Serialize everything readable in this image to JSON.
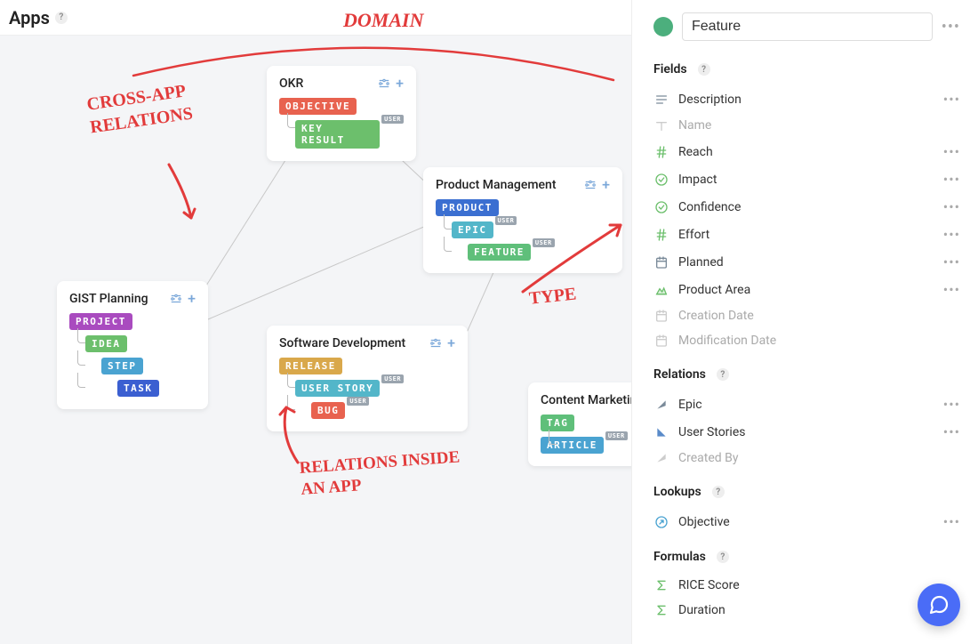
{
  "header": {
    "title": "Apps"
  },
  "annotations": {
    "domain": "DOMAIN",
    "cross_app": "CROSS-APP RELATIONS",
    "type": "TYPE",
    "inside": "RELATIONS INSIDE AN APP"
  },
  "user_badge": "USER",
  "cards": {
    "okr": {
      "title": "OKR",
      "tags": [
        {
          "label": "OBJECTIVE",
          "color": "#e8624f",
          "indent": 0,
          "user": false
        },
        {
          "label": "KEY RESULT",
          "color": "#6cbf6c",
          "indent": 1,
          "user": true
        }
      ]
    },
    "pm": {
      "title": "Product Management",
      "tags": [
        {
          "label": "PRODUCT",
          "color": "#3b6fd1",
          "indent": 0,
          "user": false
        },
        {
          "label": "EPIC",
          "color": "#53b6c9",
          "indent": 1,
          "user": true
        },
        {
          "label": "FEATURE",
          "color": "#5fbf7a",
          "indent": 2,
          "user": true
        }
      ]
    },
    "gist": {
      "title": "GIST Planning",
      "tags": [
        {
          "label": "PROJECT",
          "color": "#a94bbf",
          "indent": 0,
          "user": false
        },
        {
          "label": "IDEA",
          "color": "#6cbf6c",
          "indent": 1,
          "user": false
        },
        {
          "label": "STEP",
          "color": "#4aa3d1",
          "indent": 2,
          "user": false
        },
        {
          "label": "TASK",
          "color": "#3b5fd1",
          "indent": 3,
          "user": false
        }
      ]
    },
    "sw": {
      "title": "Software Development",
      "tags": [
        {
          "label": "RELEASE",
          "color": "#d9a84b",
          "indent": 0,
          "user": false
        },
        {
          "label": "USER STORY",
          "color": "#53b6c9",
          "indent": 1,
          "user": true
        },
        {
          "label": "BUG",
          "color": "#e8624f",
          "indent": 2,
          "user": true
        }
      ]
    },
    "cm": {
      "title": "Content Marketing",
      "tags": [
        {
          "label": "TAG",
          "color": "#5fbf7a",
          "indent": 0,
          "user": false
        },
        {
          "label": "ARTICLE",
          "color": "#4aa3d1",
          "indent": 0,
          "user": true
        }
      ]
    }
  },
  "sidebar": {
    "title_value": "Feature",
    "sections": {
      "fields": {
        "label": "Fields",
        "rows": [
          {
            "icon": "desc",
            "label": "Description",
            "muted": false,
            "dots": true
          },
          {
            "icon": "text",
            "label": "Name",
            "muted": true,
            "dots": false
          },
          {
            "icon": "hash",
            "label": "Reach",
            "muted": false,
            "dots": true
          },
          {
            "icon": "check",
            "label": "Impact",
            "muted": false,
            "dots": true
          },
          {
            "icon": "check",
            "label": "Confidence",
            "muted": false,
            "dots": true
          },
          {
            "icon": "hash",
            "label": "Effort",
            "muted": false,
            "dots": true
          },
          {
            "icon": "cal",
            "label": "Planned",
            "muted": false,
            "dots": true
          },
          {
            "icon": "area",
            "label": "Product Area",
            "muted": false,
            "dots": true
          },
          {
            "icon": "cal",
            "label": "Creation Date",
            "muted": true,
            "dots": false
          },
          {
            "icon": "cal",
            "label": "Modification Date",
            "muted": true,
            "dots": false
          }
        ]
      },
      "relations": {
        "label": "Relations",
        "rows": [
          {
            "icon": "relup",
            "label": "Epic",
            "muted": false,
            "dots": true
          },
          {
            "icon": "reldown",
            "label": "User Stories",
            "muted": false,
            "dots": true
          },
          {
            "icon": "relup",
            "label": "Created By",
            "muted": true,
            "dots": false
          }
        ]
      },
      "lookups": {
        "label": "Lookups",
        "rows": [
          {
            "icon": "lookup",
            "label": "Objective",
            "muted": false,
            "dots": true
          }
        ]
      },
      "formulas": {
        "label": "Formulas",
        "rows": [
          {
            "icon": "sigma",
            "label": "RICE Score",
            "muted": false,
            "dots": false
          },
          {
            "icon": "sigma",
            "label": "Duration",
            "muted": false,
            "dots": false
          }
        ]
      }
    }
  }
}
